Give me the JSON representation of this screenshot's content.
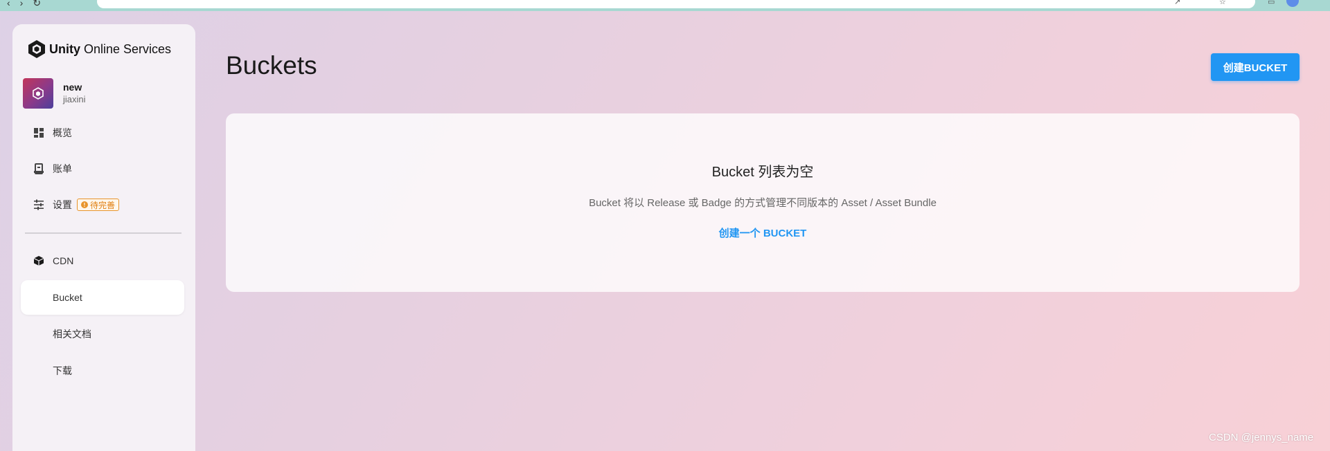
{
  "brand": {
    "name_bold": "Unity",
    "name_rest": " Online Services"
  },
  "project": {
    "name": "new",
    "org": "jiaxini"
  },
  "sidebar": {
    "items": [
      {
        "label": "概览",
        "icon": "dashboard-icon"
      },
      {
        "label": "账单",
        "icon": "billing-icon"
      },
      {
        "label": "设置",
        "icon": "settings-sliders-icon",
        "badge": "待完善",
        "badge_symbol": "!"
      }
    ],
    "section": {
      "label": "CDN",
      "icon": "cube-icon"
    },
    "sub_items": [
      {
        "label": "Bucket",
        "active": true
      },
      {
        "label": "相关文档",
        "active": false
      },
      {
        "label": "下载",
        "active": false
      }
    ]
  },
  "main": {
    "title": "Buckets",
    "create_button": "创建BUCKET",
    "empty": {
      "title": "Bucket 列表为空",
      "description": "Bucket 将以 Release 或 Badge 的方式管理不同版本的 Asset / Asset Bundle",
      "link": "创建一个 BUCKET"
    }
  },
  "watermark": "CSDN @jennys_name",
  "colors": {
    "accent": "#2196f3",
    "badge": "#e8942a",
    "chrome": "#a8d8d2"
  }
}
